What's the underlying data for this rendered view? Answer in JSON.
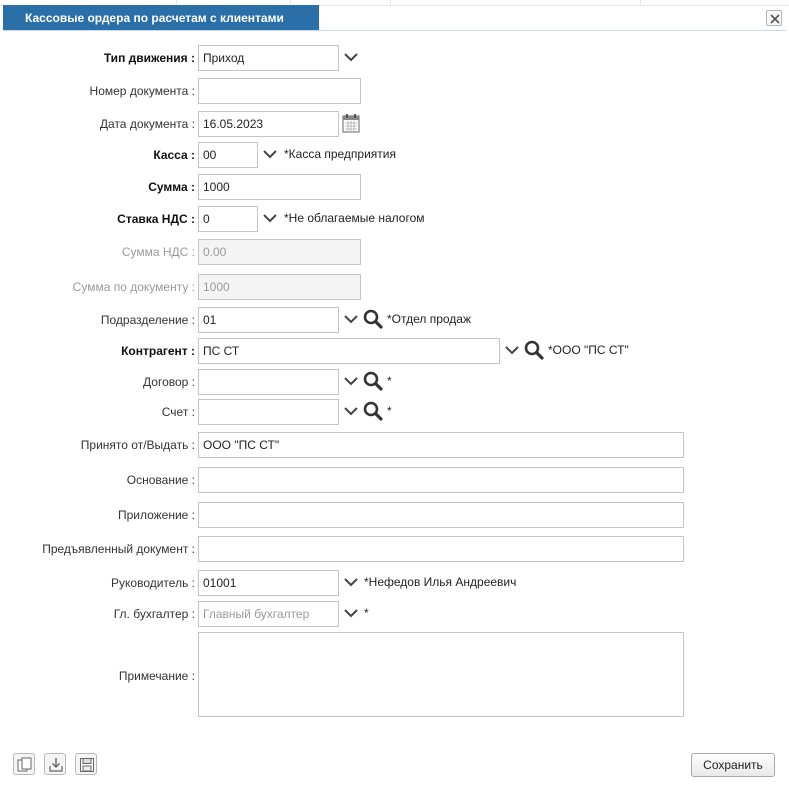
{
  "window": {
    "title": "Кассовые ордера по расчетам с клиентами"
  },
  "fields": {
    "movement_type": {
      "label": "Тип движения :",
      "value": "Приход"
    },
    "doc_number": {
      "label": "Номер документа :",
      "value": ""
    },
    "doc_date": {
      "label": "Дата документа :",
      "value": "16.05.2023"
    },
    "kassa": {
      "label": "Касса :",
      "value": "00",
      "note": "*Касса предприятия"
    },
    "summa": {
      "label": "Сумма :",
      "value": "1000"
    },
    "vat_rate": {
      "label": "Ставка НДС :",
      "value": "0",
      "note": "*Не облагаемые налогом"
    },
    "vat_sum": {
      "label": "Сумма НДС :",
      "value": "0.00"
    },
    "doc_sum": {
      "label": "Сумма по документу :",
      "value": "1000"
    },
    "department": {
      "label": "Подразделение :",
      "value": "01",
      "note": "*Отдел продаж"
    },
    "counterparty": {
      "label": "Контрагент :",
      "value": "ПС СТ",
      "note": "*ООО \"ПС СТ\""
    },
    "contract": {
      "label": "Договор :",
      "value": "",
      "note": "*"
    },
    "account": {
      "label": "Счет :",
      "value": "",
      "note": "*"
    },
    "received_from": {
      "label": "Принято от/Выдать :",
      "value": "ООО \"ПС СТ\""
    },
    "basis": {
      "label": "Основание :",
      "value": ""
    },
    "attachment": {
      "label": "Приложение :",
      "value": ""
    },
    "presented_doc": {
      "label": "Предъявленный документ :",
      "value": ""
    },
    "manager": {
      "label": "Руководитель :",
      "value": "01001",
      "note": "*Нефедов Илья Андреевич"
    },
    "chief_accountant": {
      "label": "Гл. бухгалтер :",
      "placeholder": "Главный бухгалтер",
      "note": "*"
    },
    "remark": {
      "label": "Примечание :",
      "value": ""
    }
  },
  "footer": {
    "save_label": "Сохранить",
    "icons": [
      "copy-icon",
      "download-icon",
      "save-disk-icon"
    ]
  },
  "colors": {
    "title_bar": "#2a6fa8",
    "disabled_text": "#9a9a9a"
  }
}
